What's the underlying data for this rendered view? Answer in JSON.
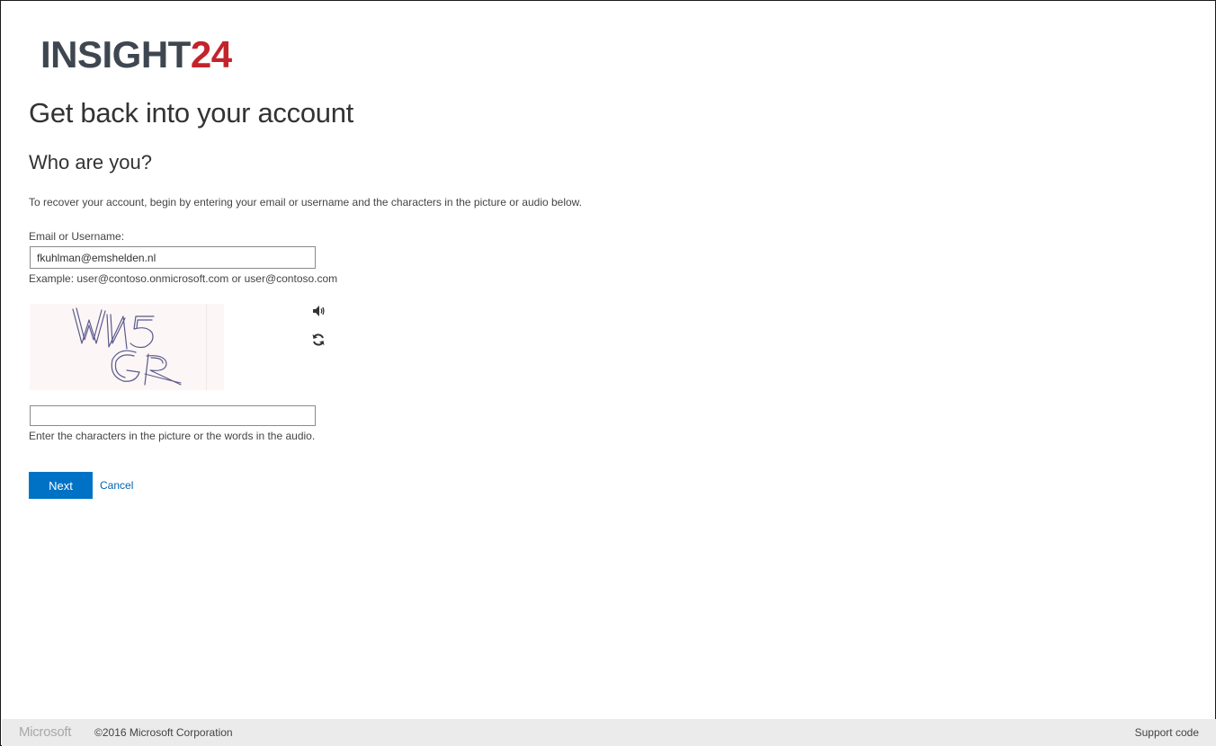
{
  "brand": {
    "logo_part1": "INSIGHT",
    "logo_part2": "24"
  },
  "page": {
    "title": "Get back into your account",
    "subtitle": "Who are you?",
    "intro": "To recover your account, begin by entering your email or username and the characters in the picture or audio below."
  },
  "form": {
    "email_label": "Email or Username:",
    "email_value": "fkuhlman@emshelden.nl",
    "email_example": "Example: user@contoso.onmicrosoft.com or user@contoso.com",
    "captcha_value": "",
    "captcha_hint": "Enter the characters in the picture or the words in the audio.",
    "next_label": "Next",
    "cancel_label": "Cancel"
  },
  "icons": {
    "audio": "speaker-icon",
    "refresh": "refresh-icon"
  },
  "footer": {
    "ms_logo": "Microsoft",
    "copyright": "©2016 Microsoft Corporation",
    "support": "Support code"
  },
  "colors": {
    "accent": "#0072c6",
    "brand_red": "#c4232b",
    "brand_dark": "#3e4650"
  }
}
